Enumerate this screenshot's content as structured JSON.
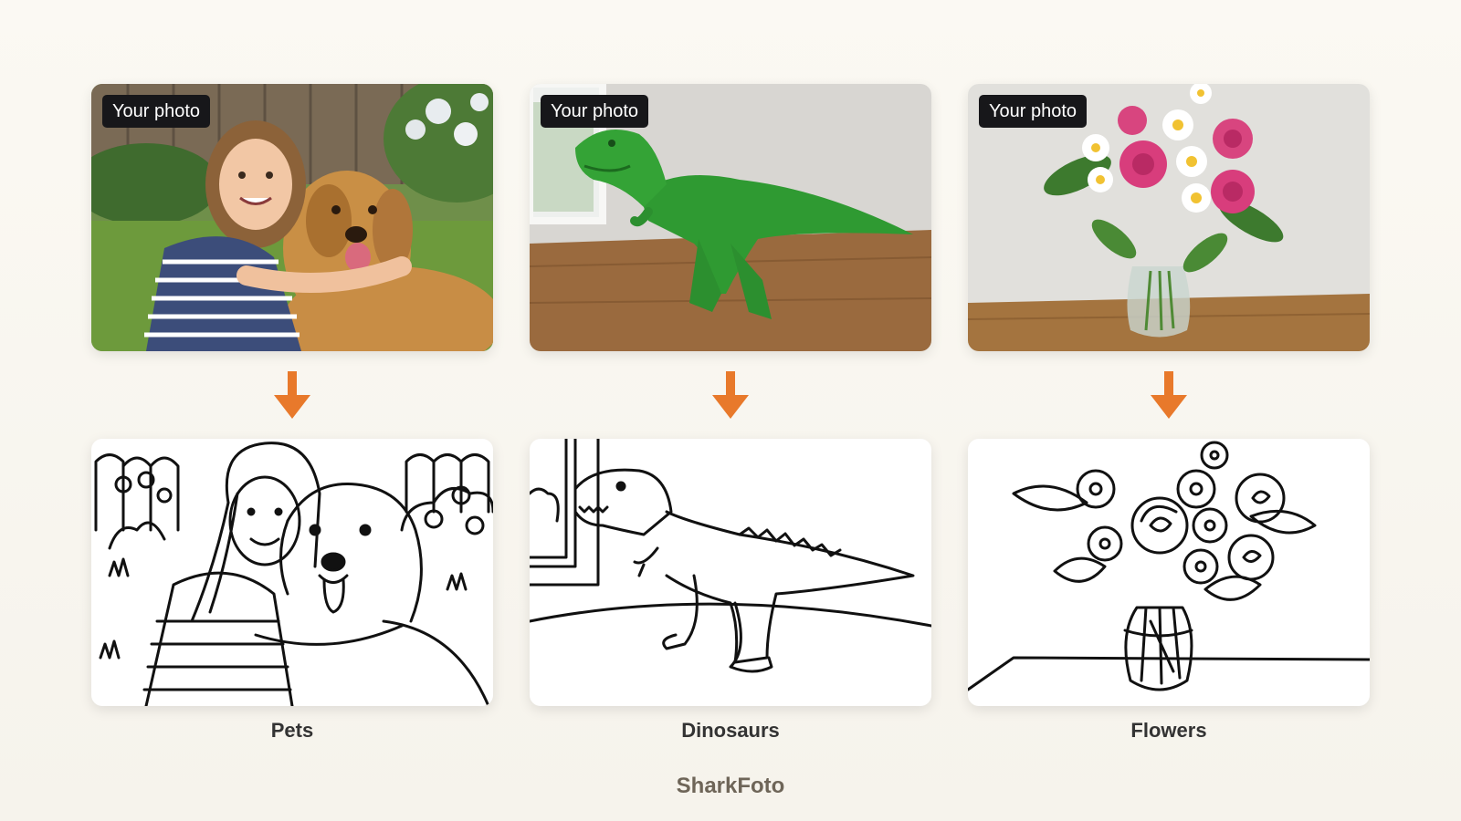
{
  "badge_label": "Your photo",
  "columns": [
    {
      "caption": "Pets"
    },
    {
      "caption": "Dinosaurs"
    },
    {
      "caption": "Flowers"
    }
  ],
  "brand": "SharkFoto",
  "colors": {
    "arrow": "#e8792b",
    "badge_bg": "#17171a",
    "background": "#f8f6f0"
  }
}
